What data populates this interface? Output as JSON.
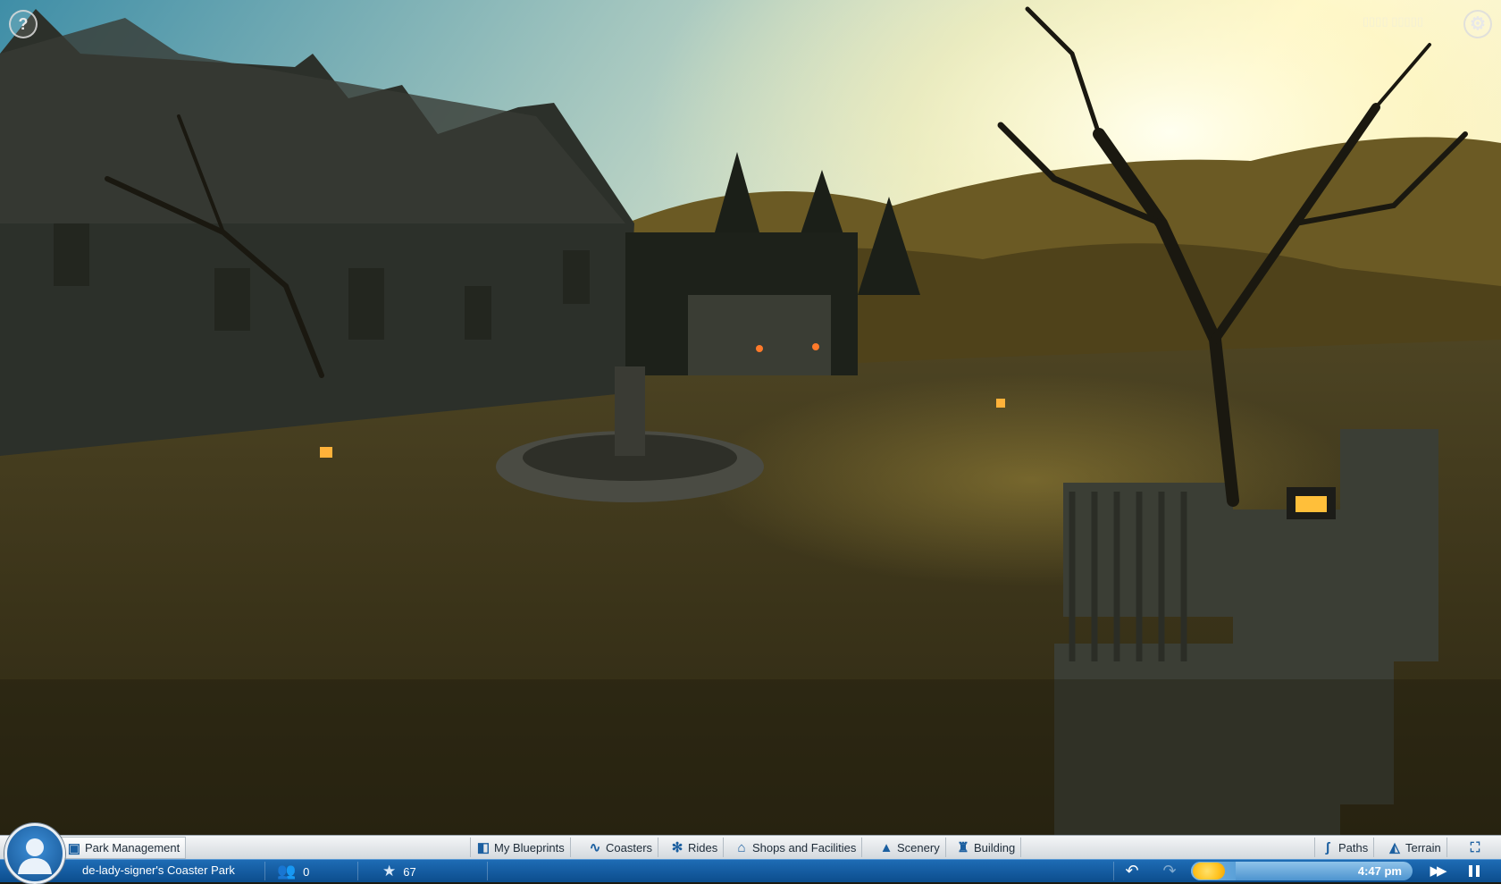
{
  "top_bar": {
    "help_icon": "question-mark-icon",
    "help_label": "?",
    "settings_icon": "gear-icon",
    "settings_label": "⚙",
    "top_right_text": "▯▯▯▯ ▯▯▯▯▯"
  },
  "toolbar": {
    "park_management": {
      "label": "Park Management",
      "icon": "clipboard-icon"
    },
    "my_blueprints": {
      "label": "My Blueprints",
      "icon": "blueprint-icon"
    },
    "coasters": {
      "label": "Coasters",
      "icon": "coaster-icon"
    },
    "rides": {
      "label": "Rides",
      "icon": "ferris-wheel-icon"
    },
    "shops": {
      "label": "Shops and Facilities",
      "icon": "shop-icon"
    },
    "scenery": {
      "label": "Scenery",
      "icon": "tree-icon"
    },
    "building": {
      "label": "Building",
      "icon": "tower-icon"
    },
    "paths": {
      "label": "Paths",
      "icon": "path-icon"
    },
    "terrain": {
      "label": "Terrain",
      "icon": "mountain-icon"
    },
    "fullscreen": {
      "icon": "fullscreen-icon"
    }
  },
  "status_bar": {
    "park_name": "de-lady-signer's Coaster Park",
    "guests": "0",
    "guests_icon": "guests-icon",
    "rating": "67",
    "rating_icon": "star-icon",
    "time": "4:47 pm",
    "time_progress": 0.2
  },
  "colors": {
    "toolbar_accent": "#1b5fa0",
    "statusbar_top": "#1e6cb5",
    "statusbar_bottom": "#0c4d8d",
    "sun": "#ffc21f"
  }
}
